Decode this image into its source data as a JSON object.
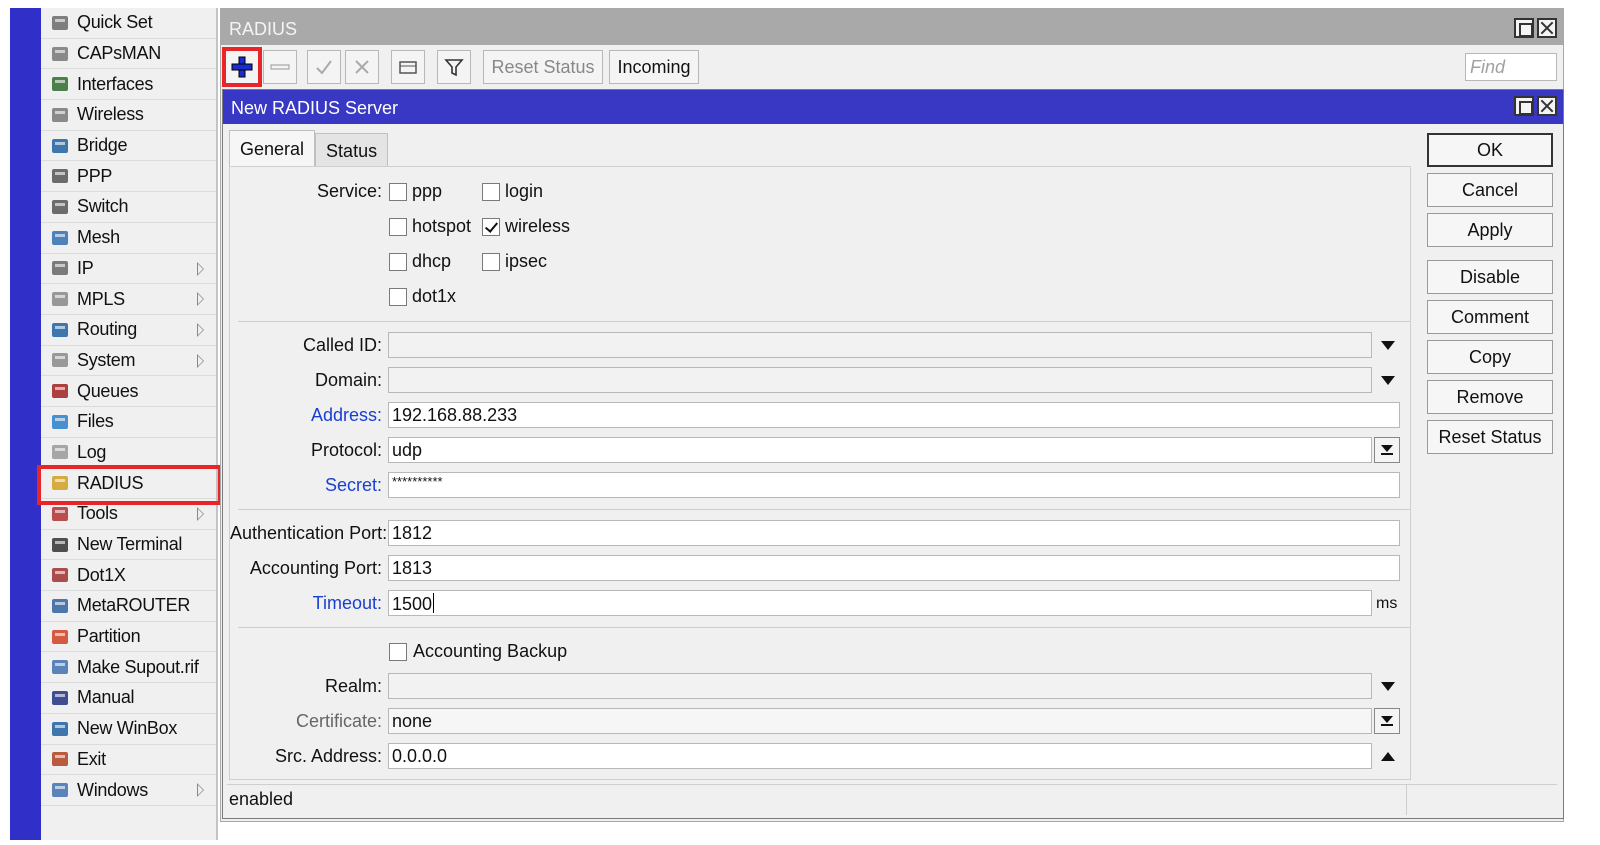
{
  "menu": {
    "items": [
      {
        "label": "Quick Set",
        "icon": "wand-icon",
        "submenu": false
      },
      {
        "label": "CAPsMAN",
        "icon": "antenna-icon",
        "submenu": false
      },
      {
        "label": "Interfaces",
        "icon": "interfaces-icon",
        "submenu": false
      },
      {
        "label": "Wireless",
        "icon": "wireless-icon",
        "submenu": false
      },
      {
        "label": "Bridge",
        "icon": "bridge-icon",
        "submenu": false
      },
      {
        "label": "PPP",
        "icon": "ppp-icon",
        "submenu": false
      },
      {
        "label": "Switch",
        "icon": "switch-icon",
        "submenu": false
      },
      {
        "label": "Mesh",
        "icon": "mesh-icon",
        "submenu": false
      },
      {
        "label": "IP",
        "icon": "ip-icon",
        "submenu": true
      },
      {
        "label": "MPLS",
        "icon": "mpls-icon",
        "submenu": true
      },
      {
        "label": "Routing",
        "icon": "routing-icon",
        "submenu": true
      },
      {
        "label": "System",
        "icon": "gear-icon",
        "submenu": true
      },
      {
        "label": "Queues",
        "icon": "queues-icon",
        "submenu": false
      },
      {
        "label": "Files",
        "icon": "folder-icon",
        "submenu": false
      },
      {
        "label": "Log",
        "icon": "log-icon",
        "submenu": false
      },
      {
        "label": "RADIUS",
        "icon": "users-icon",
        "submenu": false
      },
      {
        "label": "Tools",
        "icon": "tools-icon",
        "submenu": true
      },
      {
        "label": "New Terminal",
        "icon": "terminal-icon",
        "submenu": false
      },
      {
        "label": "Dot1X",
        "icon": "dot1x-icon",
        "submenu": false
      },
      {
        "label": "MetaROUTER",
        "icon": "metarouter-icon",
        "submenu": false
      },
      {
        "label": "Partition",
        "icon": "pie-icon",
        "submenu": false
      },
      {
        "label": "Make Supout.rif",
        "icon": "supout-icon",
        "submenu": false
      },
      {
        "label": "Manual",
        "icon": "manual-icon",
        "submenu": false
      },
      {
        "label": "New WinBox",
        "icon": "winbox-icon",
        "submenu": false
      },
      {
        "label": "Exit",
        "icon": "exit-icon",
        "submenu": false
      },
      {
        "label": "Windows",
        "icon": "windows-icon",
        "submenu": true
      }
    ]
  },
  "main_window": {
    "title": "RADIUS",
    "toolbar": {
      "reset_status": "Reset Status",
      "incoming": "Incoming",
      "find_placeholder": "Find"
    }
  },
  "dialog": {
    "title": "New RADIUS Server",
    "tabs": {
      "general": "General",
      "status": "Status"
    },
    "service_label": "Service:",
    "services": {
      "ppp": {
        "label": "ppp",
        "checked": false
      },
      "login": {
        "label": "login",
        "checked": false
      },
      "hotspot": {
        "label": "hotspot",
        "checked": false
      },
      "wireless": {
        "label": "wireless",
        "checked": true
      },
      "dhcp": {
        "label": "dhcp",
        "checked": false
      },
      "ipsec": {
        "label": "ipsec",
        "checked": false
      },
      "dot1x": {
        "label": "dot1x",
        "checked": false
      }
    },
    "fields": {
      "called_id": {
        "label": "Called ID:",
        "value": ""
      },
      "domain": {
        "label": "Domain:",
        "value": ""
      },
      "address": {
        "label": "Address:",
        "value": "192.168.88.233"
      },
      "protocol": {
        "label": "Protocol:",
        "value": "udp"
      },
      "secret": {
        "label": "Secret:",
        "value": "**********"
      },
      "auth_port": {
        "label": "Authentication Port:",
        "value": "1812"
      },
      "acct_port": {
        "label": "Accounting Port:",
        "value": "1813"
      },
      "timeout": {
        "label": "Timeout:",
        "value": "1500",
        "unit": "ms"
      },
      "accounting_backup": {
        "label": "Accounting Backup",
        "checked": false
      },
      "realm": {
        "label": "Realm:",
        "value": ""
      },
      "certificate": {
        "label": "Certificate:",
        "value": "none"
      },
      "src_address": {
        "label": "Src. Address:",
        "value": "0.0.0.0"
      }
    },
    "buttons": {
      "ok": "OK",
      "cancel": "Cancel",
      "apply": "Apply",
      "disable": "Disable",
      "comment": "Comment",
      "copy": "Copy",
      "remove": "Remove",
      "reset_status": "Reset Status"
    },
    "status_text": "enabled"
  },
  "colors": {
    "dialog_title_bar": "#3838c4",
    "side_strip": "#3030c8",
    "highlight": "#e8262a",
    "link_label": "#1a3fd0"
  }
}
